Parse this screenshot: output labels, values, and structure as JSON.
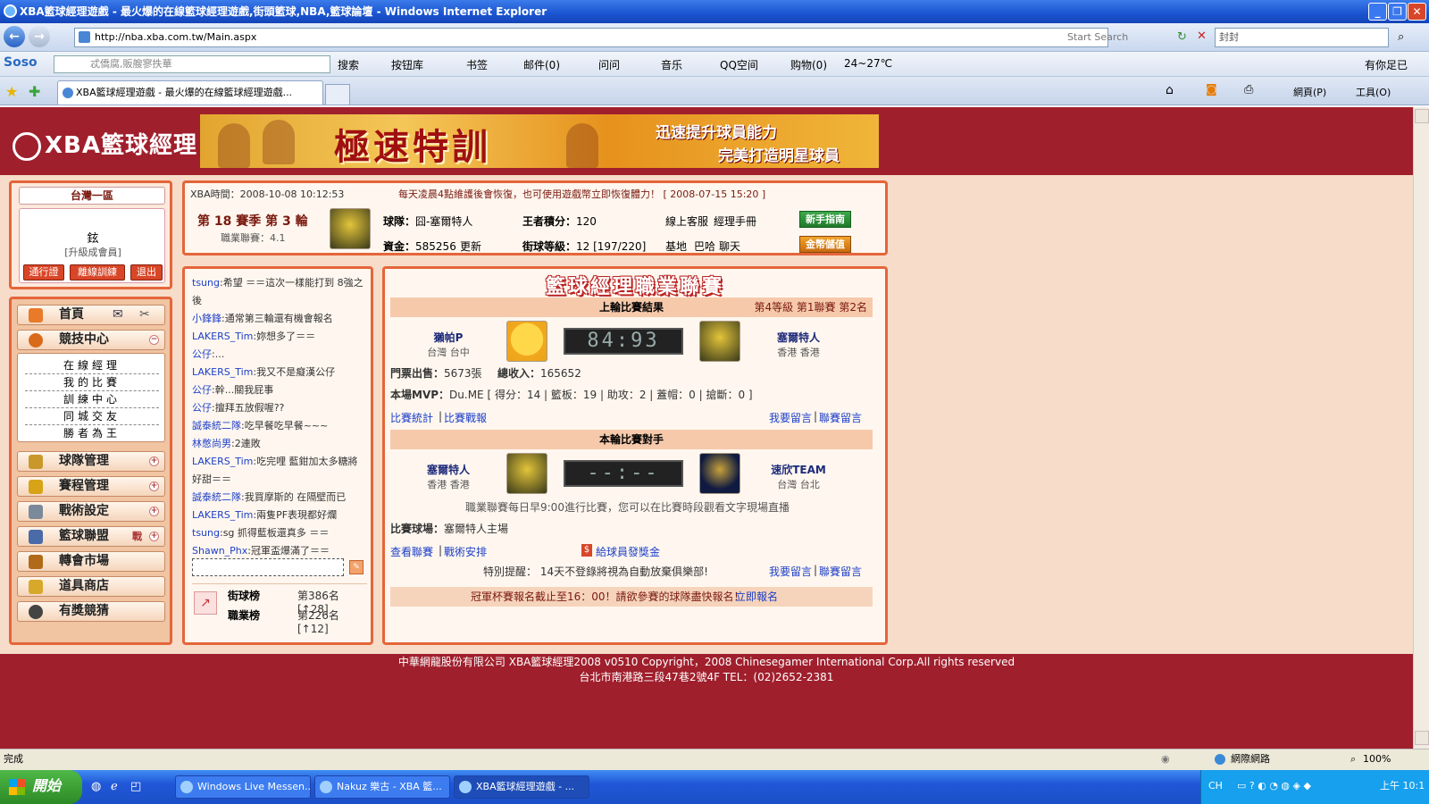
{
  "window": {
    "title": "XBA籃球經理遊戲 - 最火爆的在線籃球經理遊戲,街頭籃球,NBA,籃球論壇 - Windows Internet Explorer",
    "url": "http://nba.xba.com.tw/Main.aspx",
    "start_search": "Start Search",
    "search_value": "封封",
    "tab_title": "XBA籃球經理遊戲 - 最火爆的在線籃球經理遊戲..."
  },
  "toolbar": {
    "soso": "Soso",
    "soso_placeholder": "忒僑腐,販艘寥抶華",
    "search": "搜索",
    "items": [
      "按钮库",
      "书签",
      "邮件(0)",
      "问问",
      "音乐",
      "QQ空间",
      "购物(0)",
      "24~27℃"
    ],
    "right": "有你足已",
    "page_menu": "網頁(P)",
    "tools_menu": "工具(O)"
  },
  "site": {
    "logo": "XBA籃球經理",
    "banner_main": "極速特訓",
    "banner_sub1": "迅速提升球員能力",
    "banner_sub2": "完美打造明星球員"
  },
  "account": {
    "server": "台灣一區",
    "username": "鉉",
    "member_link": "[升級成會員]",
    "btn_pass": "通行證",
    "btn_offline": "離線訓練",
    "btn_logout": "退出"
  },
  "menu": {
    "home": "首頁",
    "competition": "競技中心",
    "sub": [
      "在線經理",
      "我的比賽",
      "訓練中心",
      "同城交友",
      "勝者為王"
    ],
    "team_mgmt": "球隊管理",
    "schedule": "賽程管理",
    "tactics": "戰術設定",
    "league": "籃球聯盟",
    "league_tag": "戰",
    "transfer": "轉會市場",
    "shop": "道具商店",
    "lottery": "有獎競猜"
  },
  "info": {
    "time_label": "XBA時間：2008-10-08 10:12:53",
    "notice": "每天凌晨4點維護後會恢復，也可使用遊戲幣立即恢復體力！ [ 2008-07-15 15:20 ]",
    "season": "第 18 賽季  第 3 輪",
    "pro_league": "職業聯賽：4.1",
    "team_label": "球隊：",
    "team_value": "囧-塞爾特人",
    "king_label": "王者積分：",
    "king_value": "120",
    "cs": "線上客服",
    "manual": "經理手冊",
    "guide_btn": "新手指南",
    "funds_label": "資金：",
    "funds_value": "585256",
    "update": "更新",
    "street_label": "街球等級：",
    "street_value": "12 [197/220]",
    "base": "基地",
    "bar": "巴哈",
    "chat": "聊天",
    "recharge_btn": "金幣儲值"
  },
  "chat": {
    "messages": [
      {
        "name": "tsung",
        "text": ":希望 ＝＝這次一樣能打到 8強之後"
      },
      {
        "name": "小鋒鋒",
        "text": ":通常第三輪還有機會報名"
      },
      {
        "name": "LAKERS_Tim",
        "text": ":妳想多了＝＝"
      },
      {
        "name": "公仔",
        "text": ":..."
      },
      {
        "name": "LAKERS_Tim",
        "text": ":我又不是癡漢公仔"
      },
      {
        "name": "公仔",
        "text": ":幹...關我屁事"
      },
      {
        "name": "公仔",
        "text": ":擅拜五放假喔??"
      },
      {
        "name": "誠泰統二隊",
        "text": ":吃早餐吃早餐~~~"
      },
      {
        "name": "林憋尚男",
        "text": ":2連敗"
      },
      {
        "name": "LAKERS_Tim",
        "text": ":吃完哩 藍鉗加太多糖將 好甜＝＝"
      },
      {
        "name": "誠泰統二隊",
        "text": ":我買摩斯的 在隔壁而已"
      },
      {
        "name": "LAKERS_Tim",
        "text": ":兩隻PF表現都好爛"
      },
      {
        "name": "tsung",
        "text": ":sg 抓得藍板還真多 ＝＝"
      },
      {
        "name": "Shawn_Phx",
        "text": ":冠軍盃爆滿了＝＝"
      }
    ],
    "rank_street": "街球榜",
    "rank_street_val": "第386名[↑28]",
    "rank_pro": "職業榜",
    "rank_pro_val": "第226名[↑12]"
  },
  "league": {
    "title": "籃球經理職業聯賽",
    "last_result": "上輪比賽結果",
    "last_meta": "第4等級  第1聯賽  第2名",
    "home_team": "獺帕P",
    "home_loc": "台灣 台中",
    "home_score": "84",
    "away_score": "93",
    "away_team": "塞爾特人",
    "away_loc": "香港 香港",
    "tickets_label": "門票出售：",
    "tickets_value": "5673張",
    "income_label": "總收入：",
    "income_value": "165652",
    "mvp_label": "本場MVP：",
    "mvp_value": "Du.ME",
    "mvp_stats": "[ 得分：14 | 籃板：19 | 助攻：2 | 蓋帽：0 | 搶斷：0 ]",
    "stats_link": "比賽統計",
    "report_link": "比賽戰報",
    "msg_link": "我要留言",
    "league_msg_link": "聯賽留言",
    "next_match": "本輪比賽對手",
    "next_home": "塞爾特人",
    "next_home_loc": "香港 香港",
    "next_score": "--:--",
    "next_away": "速欣TEAM",
    "next_away_loc": "台灣 台北",
    "schedule_note": "職業聯賽每日早9:00進行比賽，您可以在比賽時段觀看文字現場直播",
    "venue_label": "比賽球場：",
    "venue_value": "塞爾特人主場",
    "view_league": "查看聯賽",
    "tactics_arrange": "戰術安排",
    "bonus_link": "給球員發獎金",
    "warning": "特別提醒： 14天不登錄將視為自動放棄俱樂部!",
    "cup_notice": "冠軍杯賽報名截止至16：00！請欲參賽的球隊盡快報名！",
    "signup": "立即報名"
  },
  "footer": {
    "line1": "中華網龍股份有限公司 XBA籃球經理2008 v0510    Copyright，2008 Chinesegamer International Corp.All rights reserved",
    "line2": "台北市南港路三段47巷2號4F TEL：(02)2652-2381"
  },
  "status": {
    "done": "完成",
    "zone": "網際網路",
    "zoom": "100%"
  },
  "taskbar": {
    "start": "開始",
    "tasks": [
      "Windows Live Messen...",
      "Nakuz 樂古 - XBA 籃...",
      "XBA籃球經理遊戲 - ..."
    ],
    "tray_lang": "CH",
    "clock": "上午 10:1"
  }
}
